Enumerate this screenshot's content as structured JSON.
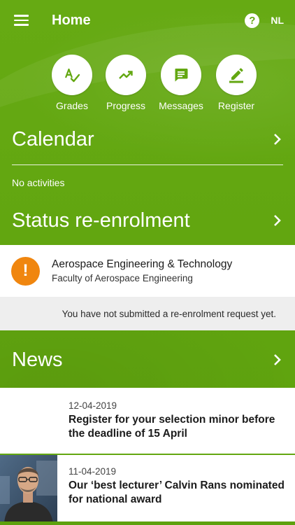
{
  "appbar": {
    "title": "Home",
    "help_glyph": "?",
    "language": "NL",
    "menu_icon": "menu-icon",
    "help_icon": "help-icon"
  },
  "quick_actions": [
    {
      "label": "Grades",
      "icon": "grades-icon"
    },
    {
      "label": "Progress",
      "icon": "trending-up-icon"
    },
    {
      "label": "Messages",
      "icon": "message-icon"
    },
    {
      "label": "Register",
      "icon": "edit-icon"
    }
  ],
  "calendar": {
    "title": "Calendar",
    "empty_text": "No activities"
  },
  "reenrolment": {
    "title": "Status re-enrolment",
    "warning_glyph": "!",
    "program": "Aerospace Engineering & Technology",
    "faculty": "Faculty of Aerospace Engineering",
    "message": "You have not submitted a re-enrolment request yet."
  },
  "news": {
    "title": "News",
    "items": [
      {
        "date": "12-04-2019",
        "title": "Register for your selection minor before the deadline of 15 April",
        "has_image": false
      },
      {
        "date": "11-04-2019",
        "title": " Our ‘best lecturer’ Calvin Rans nominated for national award",
        "has_image": true
      }
    ]
  },
  "colors": {
    "brand_green": "#63a711",
    "warning_orange": "#f0860f",
    "card_bg": "#ffffff",
    "message_bg": "#eeeeee"
  }
}
